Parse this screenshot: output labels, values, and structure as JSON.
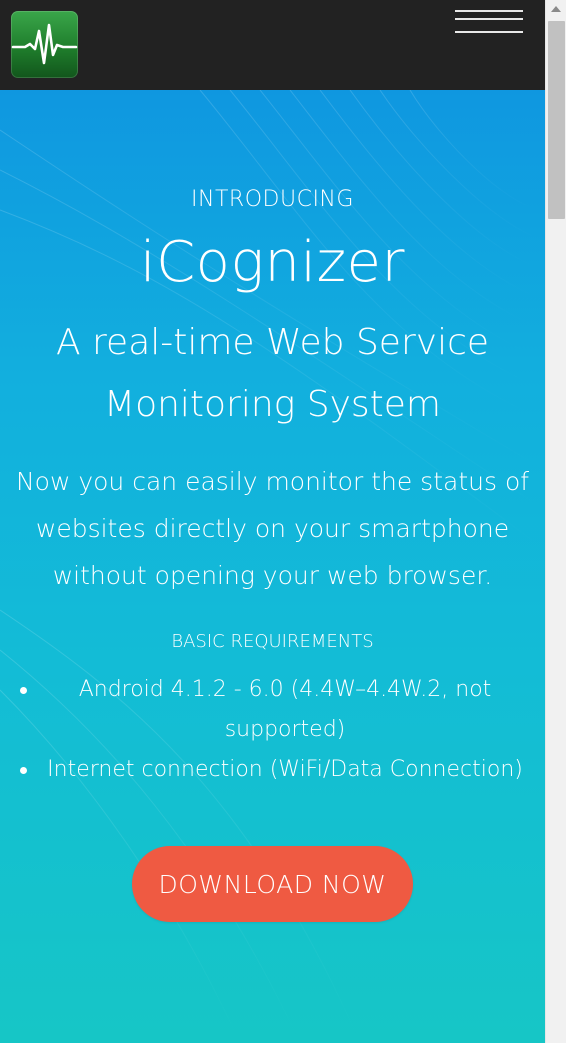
{
  "header": {
    "logo_icon": "heartbeat-pulse-icon",
    "menu_icon": "hamburger-menu-icon"
  },
  "hero": {
    "intro": "INTRODUCING",
    "app_name": "iCognizer",
    "tagline": "A real-time Web Service Monitoring System",
    "description": "Now you can easily monitor the status of websites directly on your smartphone without opening your web browser.",
    "requirements_title": "BASIC REQUIREMENTS",
    "requirements": [
      "Android 4.1.2 - 6.0 (4.4W–4.4W.2, not supported)",
      "Internet connection (WiFi/Data Connection)"
    ],
    "download_label": "DOWNLOAD NOW"
  },
  "colors": {
    "navbar": "#222222",
    "hero_top": "#0f97e0",
    "hero_bottom": "#16c6c6",
    "download_button": "#ef5a42",
    "logo_green": "#2a8f38"
  }
}
